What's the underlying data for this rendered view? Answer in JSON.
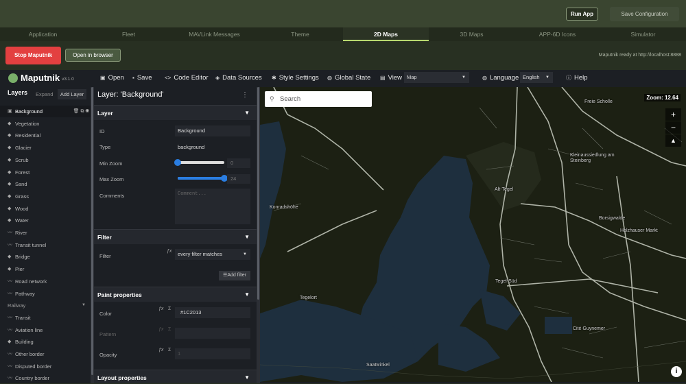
{
  "top": {
    "run_app": "Run App",
    "save_config": "Save Configuration"
  },
  "tabs": [
    "Application",
    "Fleet",
    "MAVLink Messages",
    "Theme",
    "2D Maps",
    "3D Maps",
    "APP-6D Icons",
    "Simulator"
  ],
  "actions": {
    "stop": "Stop Maputnik",
    "open_browser": "Open in browser",
    "status": "Maputnik ready at http://localhost:8888"
  },
  "toolbar": {
    "app_name": "Maputnik",
    "version": "v3.1.0",
    "open": "Open",
    "save": "Save",
    "code_editor": "Code Editor",
    "data_sources": "Data Sources",
    "style_settings": "Style Settings",
    "global_state": "Global State",
    "view": "View",
    "view_value": "Map",
    "language": "Language",
    "language_value": "English",
    "help": "Help"
  },
  "layers": {
    "title": "Layers",
    "expand": "Expand",
    "add_layer": "Add Layer",
    "items": [
      "Background",
      "Vegetation",
      "Residential",
      "Glacier",
      "Scrub",
      "Forest",
      "Sand",
      "Grass",
      "Wood",
      "Water",
      "River",
      "Transit tunnel",
      "Bridge",
      "Pier",
      "Road network",
      "Pathway",
      "Railway",
      "Transit",
      "Aviation line",
      "Building",
      "Other border",
      "Disputed border",
      "Country border"
    ]
  },
  "editor": {
    "title": "Layer: 'Background'",
    "sections": {
      "layer": "Layer",
      "filter": "Filter",
      "paint": "Paint properties",
      "layout": "Layout properties"
    },
    "labels": {
      "id": "ID",
      "type": "Type",
      "min_zoom": "Min Zoom",
      "max_zoom": "Max Zoom",
      "comments": "Comments",
      "filter": "Filter",
      "color": "Color",
      "pattern": "Pattern",
      "opacity": "Opacity"
    },
    "values": {
      "id": "Background",
      "type": "background",
      "min_zoom": "0",
      "max_zoom": "24",
      "comments_placeholder": "Comment...",
      "filter": "every filter matches",
      "color": "#1C2013",
      "opacity": "1"
    },
    "add_filter": "Add filter",
    "min_zoom_frac": 0,
    "max_zoom_frac": 1
  },
  "map": {
    "search_placeholder": "Search",
    "zoom": "Zoom: 12.64",
    "labels": [
      "Freie Scholle",
      "Kleinaussiedlung am Steinberg",
      "Alt-Tegel",
      "Konradshöhe",
      "Borsigwalde",
      "Holzhauser Markt",
      "Tegel-Süd",
      "Tegelort",
      "Cité Guynemer",
      "Saatwinkel"
    ]
  },
  "colors": {
    "stop": "#e34040",
    "accent": "#2a7de1",
    "active_tab": "#b8d870",
    "map_bg": "#1C2013",
    "water": "#1e2f3e"
  }
}
